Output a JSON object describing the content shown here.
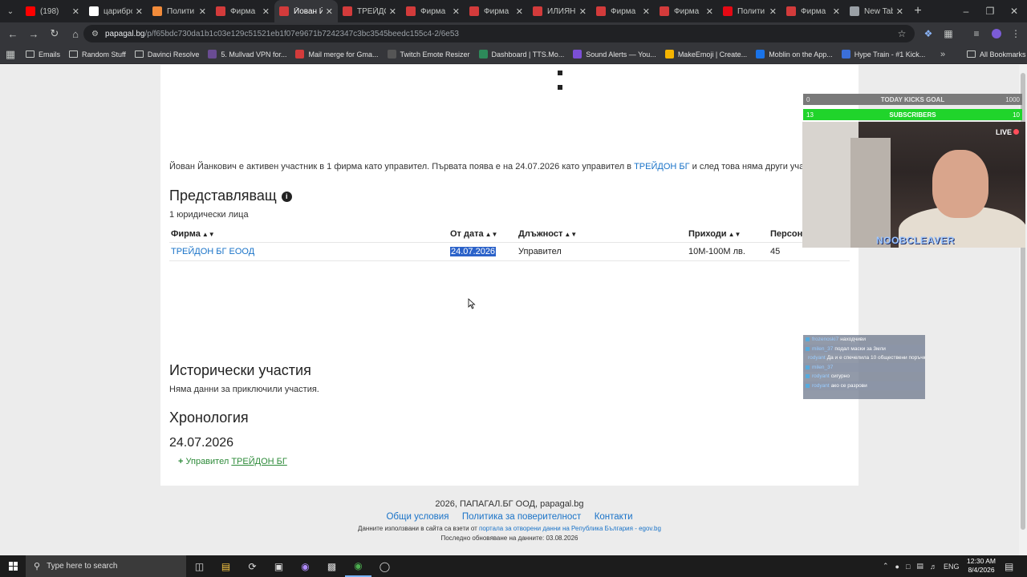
{
  "browser": {
    "tabs": [
      {
        "label": "(198)",
        "favicon": "youtube-icon",
        "color": "#ff0000",
        "active": false
      },
      {
        "label": "царибро",
        "favicon": "google-icon",
        "color": "#ffffff",
        "active": false
      },
      {
        "label": "Полити",
        "favicon": "site-icon",
        "color": "#f28b3a",
        "active": false
      },
      {
        "label": "Фирма",
        "favicon": "papagal-icon",
        "color": "#d33b3b",
        "active": false
      },
      {
        "label": "Йован Й",
        "favicon": "papagal-icon",
        "color": "#d33b3b",
        "active": true
      },
      {
        "label": "ТРЕЙДО",
        "favicon": "papagal-icon",
        "color": "#d33b3b",
        "active": false
      },
      {
        "label": "Фирма",
        "favicon": "papagal-icon",
        "color": "#d33b3b",
        "active": false
      },
      {
        "label": "Фирма",
        "favicon": "papagal-icon",
        "color": "#d33b3b",
        "active": false
      },
      {
        "label": "ИЛИЯН",
        "favicon": "papagal-icon",
        "color": "#d33b3b",
        "active": false
      },
      {
        "label": "Фирма",
        "favicon": "papagal-icon",
        "color": "#d33b3b",
        "active": false
      },
      {
        "label": "Фирма",
        "favicon": "papagal-icon",
        "color": "#d33b3b",
        "active": false
      },
      {
        "label": "Полити",
        "favicon": "n-icon",
        "color": "#e50914",
        "active": false
      },
      {
        "label": "Фирма",
        "favicon": "papagal-icon",
        "color": "#d33b3b",
        "active": false
      },
      {
        "label": "New Tab",
        "favicon": "chrome-icon",
        "color": "#9aa0a6",
        "active": false
      }
    ],
    "url_host": "papagal.bg",
    "url_path": "/p/f65bdc730da1b1c03e129c51521eb1f07e9671b7242347c3bc3545beedc155c4-2/6e53",
    "bookmarks": [
      {
        "label": "Emails",
        "icon": "folder-icon"
      },
      {
        "label": "Random Stuff",
        "icon": "folder-icon"
      },
      {
        "label": "Davinci Resolve",
        "icon": "folder-icon"
      },
      {
        "label": "5. Mullvad VPN for...",
        "icon": "mullvad-icon"
      },
      {
        "label": "Mail merge for Gma...",
        "icon": "mailmerge-icon"
      },
      {
        "label": "Twitch Emote Resizer",
        "icon": "twitch-icon"
      },
      {
        "label": "Dashboard | TTS.Mo...",
        "icon": "tts-icon"
      },
      {
        "label": "Sound Alerts — You...",
        "icon": "soundalerts-icon"
      },
      {
        "label": "MakeEmoji | Create...",
        "icon": "makeemoji-icon"
      },
      {
        "label": "Moblin on the App...",
        "icon": "appstore-icon"
      },
      {
        "label": "Hype Train - #1 Kick...",
        "icon": "hypetrain-icon"
      }
    ],
    "all_bookmarks": "All Bookmarks"
  },
  "page": {
    "intro_before": "Йован Йанкович е активен участник в 1 фирма като управител. Първата поява е на 24.07.2026 като управител в ",
    "intro_link": "ТРЕЙДОН БГ",
    "intro_after": " и след това няма други участия.",
    "rep_heading": "Представляващ",
    "rep_count": "1 юридически лица",
    "table_headers": [
      "Фирма",
      "От дата",
      "Длъжност",
      "Приходи",
      "Персон"
    ],
    "table_row": {
      "company": "ТРЕЙДОН БГ ЕООД",
      "from_date": "24.07.2026",
      "position": "Управител",
      "revenue": "10М-100М лв.",
      "staff": "45"
    },
    "hist_heading": "Исторически участия",
    "hist_text": "Няма данни за приключили участия.",
    "chrono_heading": "Хронология",
    "chrono_date": "24.07.2026",
    "chrono_role": "Управител",
    "chrono_company": "ТРЕЙДОН БГ"
  },
  "footer": {
    "copyright": "2026, ПАПАГАЛ.БГ ООД, papagal.bg",
    "links": [
      "Общи условия",
      "Политика за поверителност",
      "Контакти"
    ],
    "source_before": "Данните използвани в сайта са взети от ",
    "source_link": "портала за отворени данни на Република България - egov.bg",
    "updated": "Последно обновяване на данните: 03.08.2026"
  },
  "overlay": {
    "kicks_label": "TODAY KICKS GOAL",
    "kicks_current": "0",
    "kicks_goal": "1000",
    "subs_label": "SUBSCRIBERS",
    "subs_current": "13",
    "subs_goal": "10",
    "live_label": "LIVE",
    "streamer": "NOOBCLEAVER",
    "chat": [
      {
        "user": "frozenoski7",
        "msg": "находчиви"
      },
      {
        "user": "milen_37",
        "msg": "подал маски за 3мли"
      },
      {
        "user": "rodyant",
        "msg": "Да и е спечелила 10 обществени поръчки"
      },
      {
        "user": "milen_37",
        "msg": ""
      },
      {
        "user": "rodyant",
        "msg": "сигурно"
      },
      {
        "user": "rodyant",
        "msg": "ако се разрови"
      }
    ]
  },
  "taskbar": {
    "search_placeholder": "Type here to search",
    "lang": "ENG",
    "time": "12:30 AM",
    "date": "8/4/2026"
  }
}
